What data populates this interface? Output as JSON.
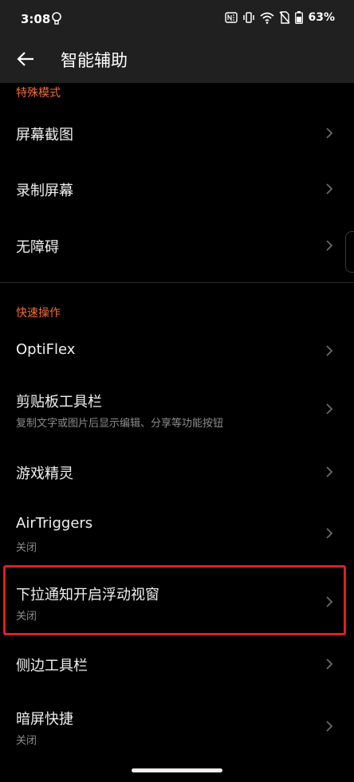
{
  "status_bar": {
    "time": "3:08",
    "battery": "63%",
    "icons": [
      "lightbulb-icon",
      "nfc-icon",
      "vibrate-icon",
      "wifi-icon",
      "no-sim-icon",
      "battery-icon"
    ]
  },
  "app_bar": {
    "title": "智能辅助",
    "back_icon": "arrow-left-icon"
  },
  "sections": [
    {
      "header": "特殊模式",
      "items": [
        {
          "title": "屏幕截图"
        },
        {
          "title": "录制屏幕"
        },
        {
          "title": "无障碍"
        }
      ]
    },
    {
      "header": "快速操作",
      "items": [
        {
          "title": "OptiFlex"
        },
        {
          "title": "剪贴板工具栏",
          "subtitle": "复制文字或图片后显示编辑、分享等功能按钮"
        },
        {
          "title": "游戏精灵"
        },
        {
          "title": "AirTriggers",
          "subtitle": "关闭"
        },
        {
          "title": "下拉通知开启浮动视窗",
          "subtitle": "关闭",
          "highlighted": true
        },
        {
          "title": "侧边工具栏"
        },
        {
          "title": "暗屏快捷",
          "subtitle": "关闭"
        }
      ]
    }
  ],
  "colors": {
    "accent": "#f26b3a",
    "highlight": "#e02020",
    "background": "#000000",
    "bar": "#202020"
  }
}
